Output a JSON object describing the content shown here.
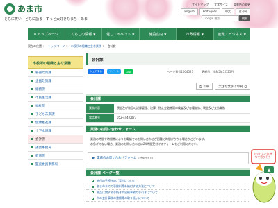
{
  "header": {
    "logo_text": "あま市",
    "tagline": "ともに笑い　ともに語る　ずっと大好きなまち　あま",
    "util_links": [
      "サイトマップ",
      "文字サイズ",
      "背景色の変更"
    ],
    "languages": [
      "English",
      "Português",
      "中文",
      "한국어"
    ],
    "search_placeholder": "Google 検索",
    "search_button": "検索"
  },
  "nav": {
    "items": [
      {
        "label": "トップページ"
      },
      {
        "label": "くらしの情報"
      },
      {
        "label": "催し・イベント"
      },
      {
        "label": "施設案内"
      },
      {
        "label": "市政情報"
      },
      {
        "label": "産業・ビジネス"
      }
    ]
  },
  "breadcrumb": {
    "current_label": "現在の位置",
    "items": [
      "トップページ",
      "市役所の組織と主な業務",
      "会計課"
    ]
  },
  "sidebar": {
    "heading": "市役所の組織と主な業務",
    "items": [
      "秘書政策課",
      "企画政策課",
      "総務課",
      "市民生活課",
      "福祉課",
      "子ども未来課",
      "健康推進課",
      "上下水道課",
      "会計課",
      "議会事務局",
      "教育課",
      "監査委員事務局"
    ],
    "current_index": 8
  },
  "main": {
    "title": "会計課",
    "share": {
      "fb": "シェアする",
      "tw": "ツイート",
      "line": "LINE"
    },
    "page_id": "ページ番号1004527",
    "updated": "更新日：令和5年5月25日",
    "tools": {
      "print": "印刷",
      "large_text": "大きな文字で印刷"
    },
    "section_title": "会計課",
    "info": [
      {
        "label": "業務内容",
        "value": "現金及び物品の記録管理、決算、指定金融機関の検査及び各種支払、現金及び支払業務"
      },
      {
        "label": "電話番号",
        "value": "052-444-0073"
      }
    ],
    "contact_title": "業務のお問い合わせフォーム",
    "contact_text_1": "業務の時間や時間帯によりお電話でのお問い合わせが困難に時間がかかる場合がございます。",
    "contact_text_2": "お急ぎでない場合、業務のお問い合わせは24時間受付けるフォームをご利用ください。",
    "form_link": "業務のお問い合わせフォーム",
    "form_link_sub": "(外部サイト)",
    "list_title": "会計課 ページ一覧",
    "list_items": [
      "納付の手続きのご案内について",
      "あま市までの手数料等を納付する方法について",
      "物品に関する手続きや出納事務の手引きについて",
      "市の会計事務の書類等の取り扱いについて"
    ]
  },
  "pagetop": {
    "label": "▲"
  },
  "mascot_sign": "ホッとした気持ちで寄りそう"
}
